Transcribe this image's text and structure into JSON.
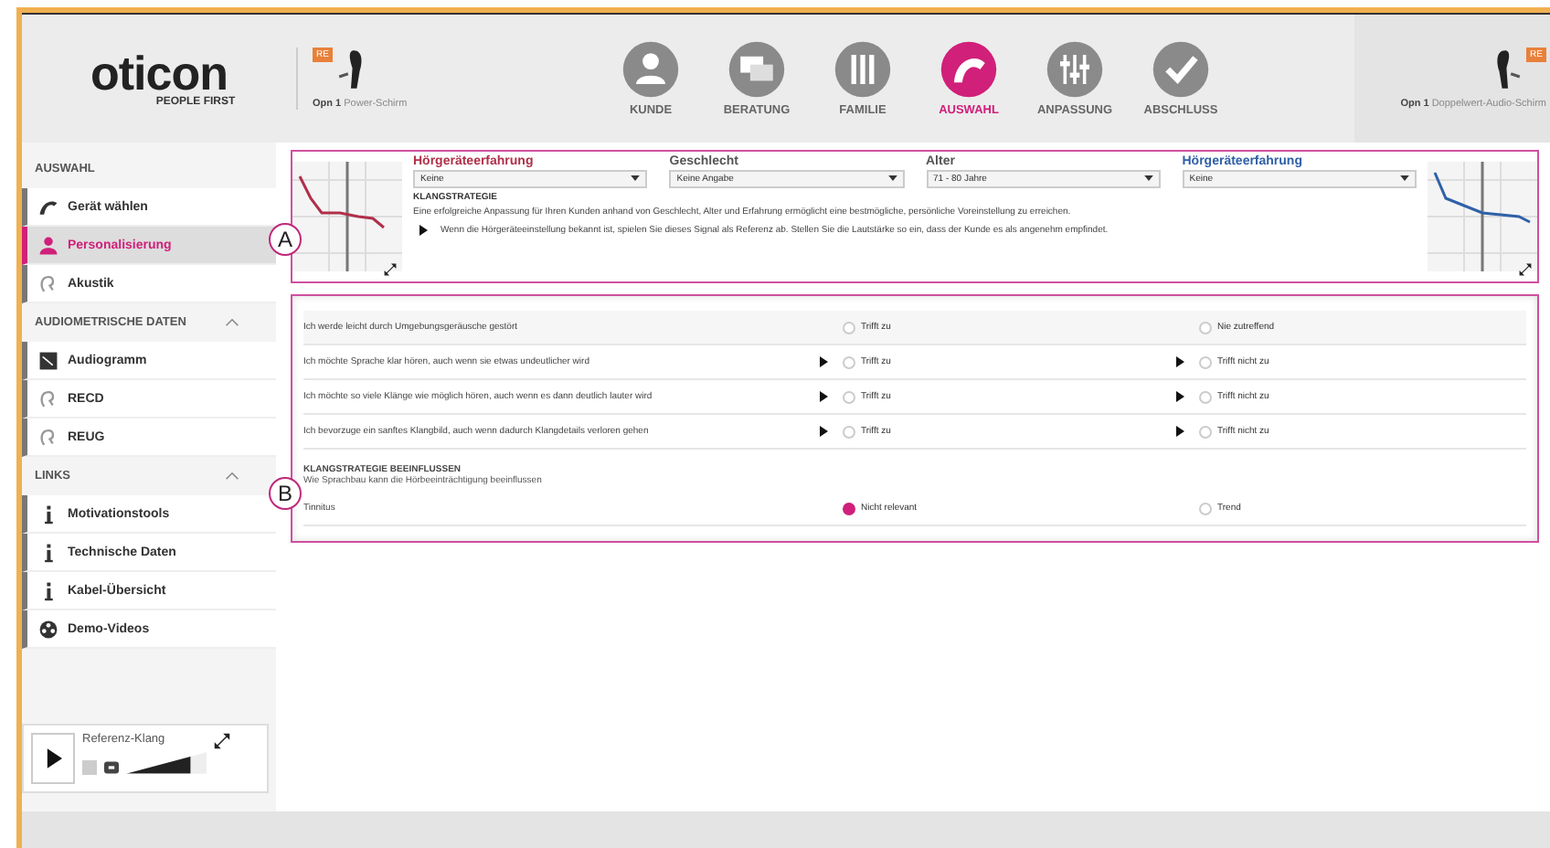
{
  "header": {
    "logo": "oticon",
    "tagline": "PEOPLE FIRST",
    "left_device": {
      "badge": "RE",
      "model": "Opn 1",
      "style": "Power-Schirm"
    },
    "right_device": {
      "badge": "RE",
      "model": "Opn 1",
      "style": "Doppelwert-Audio-Schirm"
    }
  },
  "steps": [
    {
      "label": "KUNDE",
      "kind": "person",
      "selected": false
    },
    {
      "label": "BERATUNG",
      "kind": "chat",
      "selected": false
    },
    {
      "label": "FAMILIE",
      "kind": "family",
      "selected": false
    },
    {
      "label": "AUSWAHL",
      "kind": "device",
      "selected": true
    },
    {
      "label": "ANPASSUNG",
      "kind": "sliders",
      "selected": false
    },
    {
      "label": "ABSCHLUSS",
      "kind": "check",
      "selected": false
    }
  ],
  "sidebar": [
    {
      "title": "AUSWAHL",
      "collapsible": false,
      "items": [
        {
          "label": "Gerät wählen",
          "kind": "device",
          "selected": false
        },
        {
          "label": "Personalisierung",
          "kind": "person",
          "selected": true
        },
        {
          "label": "Akustik",
          "kind": "ear",
          "selected": false
        }
      ]
    },
    {
      "title": "AUDIOMETRISCHE DATEN",
      "collapsible": true,
      "items": [
        {
          "label": "Audiogramm",
          "kind": "audiogram",
          "selected": false
        },
        {
          "label": "RECD",
          "kind": "ear",
          "selected": false
        },
        {
          "label": "REUG",
          "kind": "ear",
          "selected": false
        }
      ]
    },
    {
      "title": "LINKS",
      "collapsible": true,
      "items": [
        {
          "label": "Motivationstools",
          "kind": "info",
          "selected": false
        },
        {
          "label": "Technische Daten",
          "kind": "info",
          "selected": false
        },
        {
          "label": "Kabel-Übersicht",
          "kind": "info",
          "selected": false
        },
        {
          "label": "Demo-Videos",
          "kind": "film",
          "selected": false
        }
      ]
    }
  ],
  "reference_sound": {
    "label": "Referenz-Klang",
    "level": 0.8
  },
  "callouts": [
    "A",
    "B"
  ],
  "panel_a": {
    "dropdowns": [
      {
        "label": "Hörgeräteerfahrung",
        "value": "Keine",
        "color": "#b0304a"
      },
      {
        "label": "Geschlecht",
        "value": "Keine Angabe",
        "color": "#555555"
      },
      {
        "label": "Alter",
        "value": "71 - 80 Jahre",
        "color": "#555555"
      },
      {
        "label": "Hörgeräteerfahrung",
        "value": "Keine",
        "color": "#3060a8"
      }
    ],
    "heading": "KLANGSTRATEGIE",
    "description": "Eine erfolgreiche Anpassung für Ihren Kunden anhand von Geschlecht, Alter und Erfahrung ermöglicht eine bestmögliche, persönliche Voreinstellung zu erreichen.",
    "play_hint": "Wenn die Hörgeräteeinstellung bekannt ist, spielen Sie dieses Signal als Referenz ab. Stellen Sie die Lautstärke so ein, dass der Kunde es als angenehm empfindet."
  },
  "panel_b": {
    "questions": [
      {
        "text": "Ich werde leicht durch Umgebungsgeräusche gestört",
        "playable": false,
        "options": [
          {
            "label": "Trifft zu",
            "selected": false
          },
          {
            "label": "Nie zutreffend",
            "selected": false
          }
        ]
      },
      {
        "text": "Ich möchte Sprache klar hören, auch wenn sie etwas undeutlicher wird",
        "playable": true,
        "options": [
          {
            "label": "Trifft zu",
            "selected": false
          },
          {
            "label": "Trifft nicht zu",
            "selected": false
          }
        ]
      },
      {
        "text": "Ich möchte so viele Klänge wie möglich hören, auch wenn es dann deutlich lauter wird",
        "playable": true,
        "options": [
          {
            "label": "Trifft zu",
            "selected": false
          },
          {
            "label": "Trifft nicht zu",
            "selected": false
          }
        ]
      },
      {
        "text": "Ich bevorzuge ein sanftes Klangbild, auch wenn dadurch Klangdetails verloren gehen",
        "playable": true,
        "options": [
          {
            "label": "Trifft zu",
            "selected": false
          },
          {
            "label": "Trifft nicht zu",
            "selected": false
          }
        ]
      }
    ],
    "section_title": "KLANGSTRATEGIE BEEINFLUSSEN",
    "section_text": "Wie Sprachbau kann die Hörbeeinträchtigung beeinflussen",
    "extra": {
      "text": "Tinnitus",
      "options": [
        {
          "label": "Nicht relevant",
          "selected": true
        },
        {
          "label": "Trend",
          "selected": false
        }
      ]
    }
  }
}
